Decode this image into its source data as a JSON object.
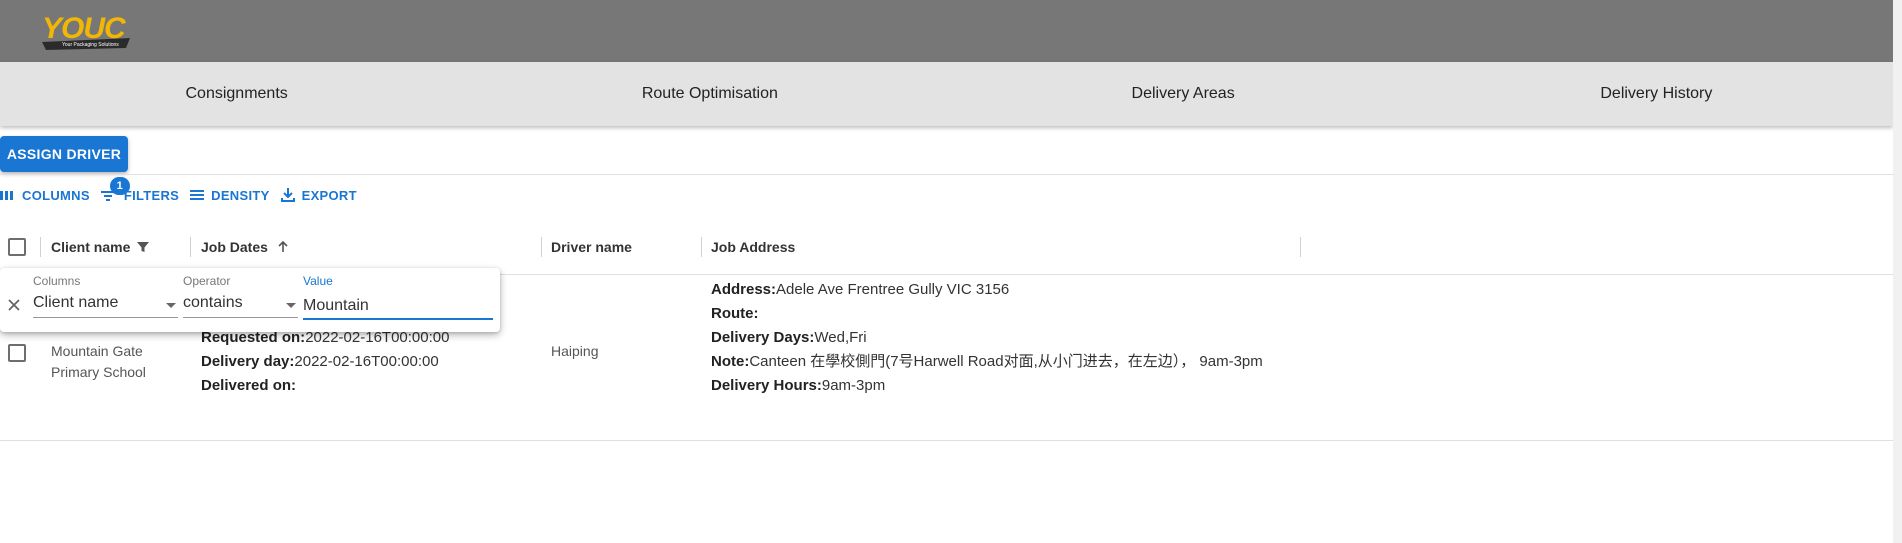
{
  "brand": {
    "logo_text": "YOUC",
    "logo_tagline": "Your Packaging Solutions"
  },
  "nav": {
    "items": [
      {
        "label": "Consignments"
      },
      {
        "label": "Route Optimisation"
      },
      {
        "label": "Delivery Areas"
      },
      {
        "label": "Delivery History"
      }
    ]
  },
  "actions": {
    "assign_driver": "ASSIGN DRIVER"
  },
  "toolbar": {
    "columns": "COLUMNS",
    "filters": "FILTERS",
    "filter_count": "1",
    "density": "DENSITY",
    "export": "EXPORT"
  },
  "columns": {
    "client_name": "Client name",
    "job_dates": "Job Dates",
    "driver_name": "Driver name",
    "job_address": "Job Address"
  },
  "row": {
    "client_name_line1": "Mountain Gate",
    "client_name_line2": "Primary School",
    "requested_label": "Requested on:",
    "requested_value": "2022-02-16T00:00:00",
    "delivery_day_label": "Delivery day:",
    "delivery_day_value": "2022-02-16T00:00:00",
    "delivered_label": "Delivered on:",
    "delivered_value": "",
    "driver": "Haiping",
    "address_label": "Address:",
    "address_value": "Adele Ave Frentree Gully VIC 3156",
    "route_label": "Route:",
    "route_value": "",
    "delivery_days_label": "Delivery Days:",
    "delivery_days_value": "Wed,Fri",
    "note_label": "Note:",
    "note_value": "Canteen 在學校側門(7号Harwell Road对面,从小门进去，在左边）， 9am-3pm",
    "delivery_hours_label": "Delivery Hours:",
    "delivery_hours_value": "9am-3pm"
  },
  "filter_panel": {
    "columns_label": "Columns",
    "columns_value": "Client name",
    "operator_label": "Operator",
    "operator_value": "contains",
    "value_label": "Value",
    "value_value": "Mountain"
  },
  "colors": {
    "primary": "#1976d2",
    "topbar": "#777777",
    "nav": "#e3e3e3",
    "logo": "#f2b705"
  }
}
